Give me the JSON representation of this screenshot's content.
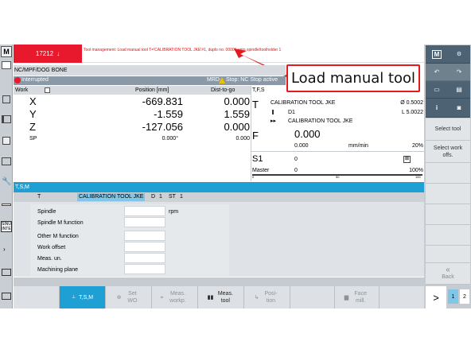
{
  "alarm": {
    "number": "17212",
    "arrow": "↓",
    "message": "Tool management: Load manual tool T='CALIBRATION TOOL JKE'#1, duplo no. 00001 onto spindle/toolholder 1"
  },
  "callout": "Load manual tool",
  "program": {
    "path": "NC/MPF/DOG BONE",
    "status": "Interrupted",
    "mode_status": "MRD",
    "stop_status": "Stop: NC Stop active"
  },
  "coords": {
    "col_work": "Work",
    "col_position": "Position [mm]",
    "col_dtg": "Dist-to-go",
    "rows": [
      {
        "axis": "X",
        "pos": "-669.831",
        "dtg": "0.000"
      },
      {
        "axis": "Y",
        "pos": "-1.559",
        "dtg": "1.559"
      },
      {
        "axis": "Z",
        "pos": "-127.056",
        "dtg": "0.000"
      },
      {
        "axis": "SP",
        "pos": "0.000°",
        "dtg": "0.000"
      }
    ]
  },
  "tfs": {
    "header": "T,F,S",
    "t_label": "T",
    "tool": "CALIBRATION TOOL JKE",
    "diameter": "Ø 0.5002",
    "d": "D1",
    "length": "L 5.0022",
    "next_tool": "CALIBRATION TOOL JKE",
    "f_label": "F",
    "feed": "0.000",
    "feed2": "0.000",
    "feed_unit": "mm/min",
    "feed_pct": "20%",
    "s_label": "S1",
    "speed": "0",
    "master": "Master",
    "master_val": "0",
    "spindle_pct": "100%",
    "scale_0": "0",
    "scale_50": "50",
    "scale_100": "100"
  },
  "tsm": {
    "title": "T,S,M",
    "t_label": "T",
    "tool": "CALIBRATION TOOL JKE",
    "d_label": "D",
    "d_val": "1",
    "st_label": "ST",
    "st_val": "1",
    "spindle": "Spindle",
    "spindle_unit": "rpm",
    "spindle_m": "Spindle M function",
    "other_m": "Other M function",
    "work_offset": "Work offset",
    "meas_un": "Meas. un.",
    "machining_plane": "Machining plane"
  },
  "right_softkeys": {
    "select_tool": "Select tool",
    "select_work": "Select work offs.",
    "back": "Back",
    "next": ">",
    "page1": "1",
    "page2": "2"
  },
  "bottom_softkeys": [
    {
      "label": "T,S,M",
      "active": true
    },
    {
      "label": "Set WO",
      "active": false
    },
    {
      "label": "Meas. workp.",
      "active": false
    },
    {
      "label": "Meas. tool",
      "active": true
    },
    {
      "label": "Posi- tion",
      "active": false
    },
    {
      "label": "",
      "active": false
    },
    {
      "label": "Face mill.",
      "active": false
    },
    {
      "label": "",
      "active": false
    }
  ],
  "left_icons": [
    "M",
    "edit",
    "group",
    "machine",
    "mirror",
    "tool",
    "wrench",
    "split",
    "sinu",
    "arrow"
  ],
  "top_right_icons": [
    "M-icon",
    "grid-icon"
  ],
  "colors": {
    "alarm_bg": "#e8192c",
    "header_blue": "#1fa0d4",
    "dark_softkey": "#4d6273",
    "panel_gray": "#dfe3e7"
  }
}
